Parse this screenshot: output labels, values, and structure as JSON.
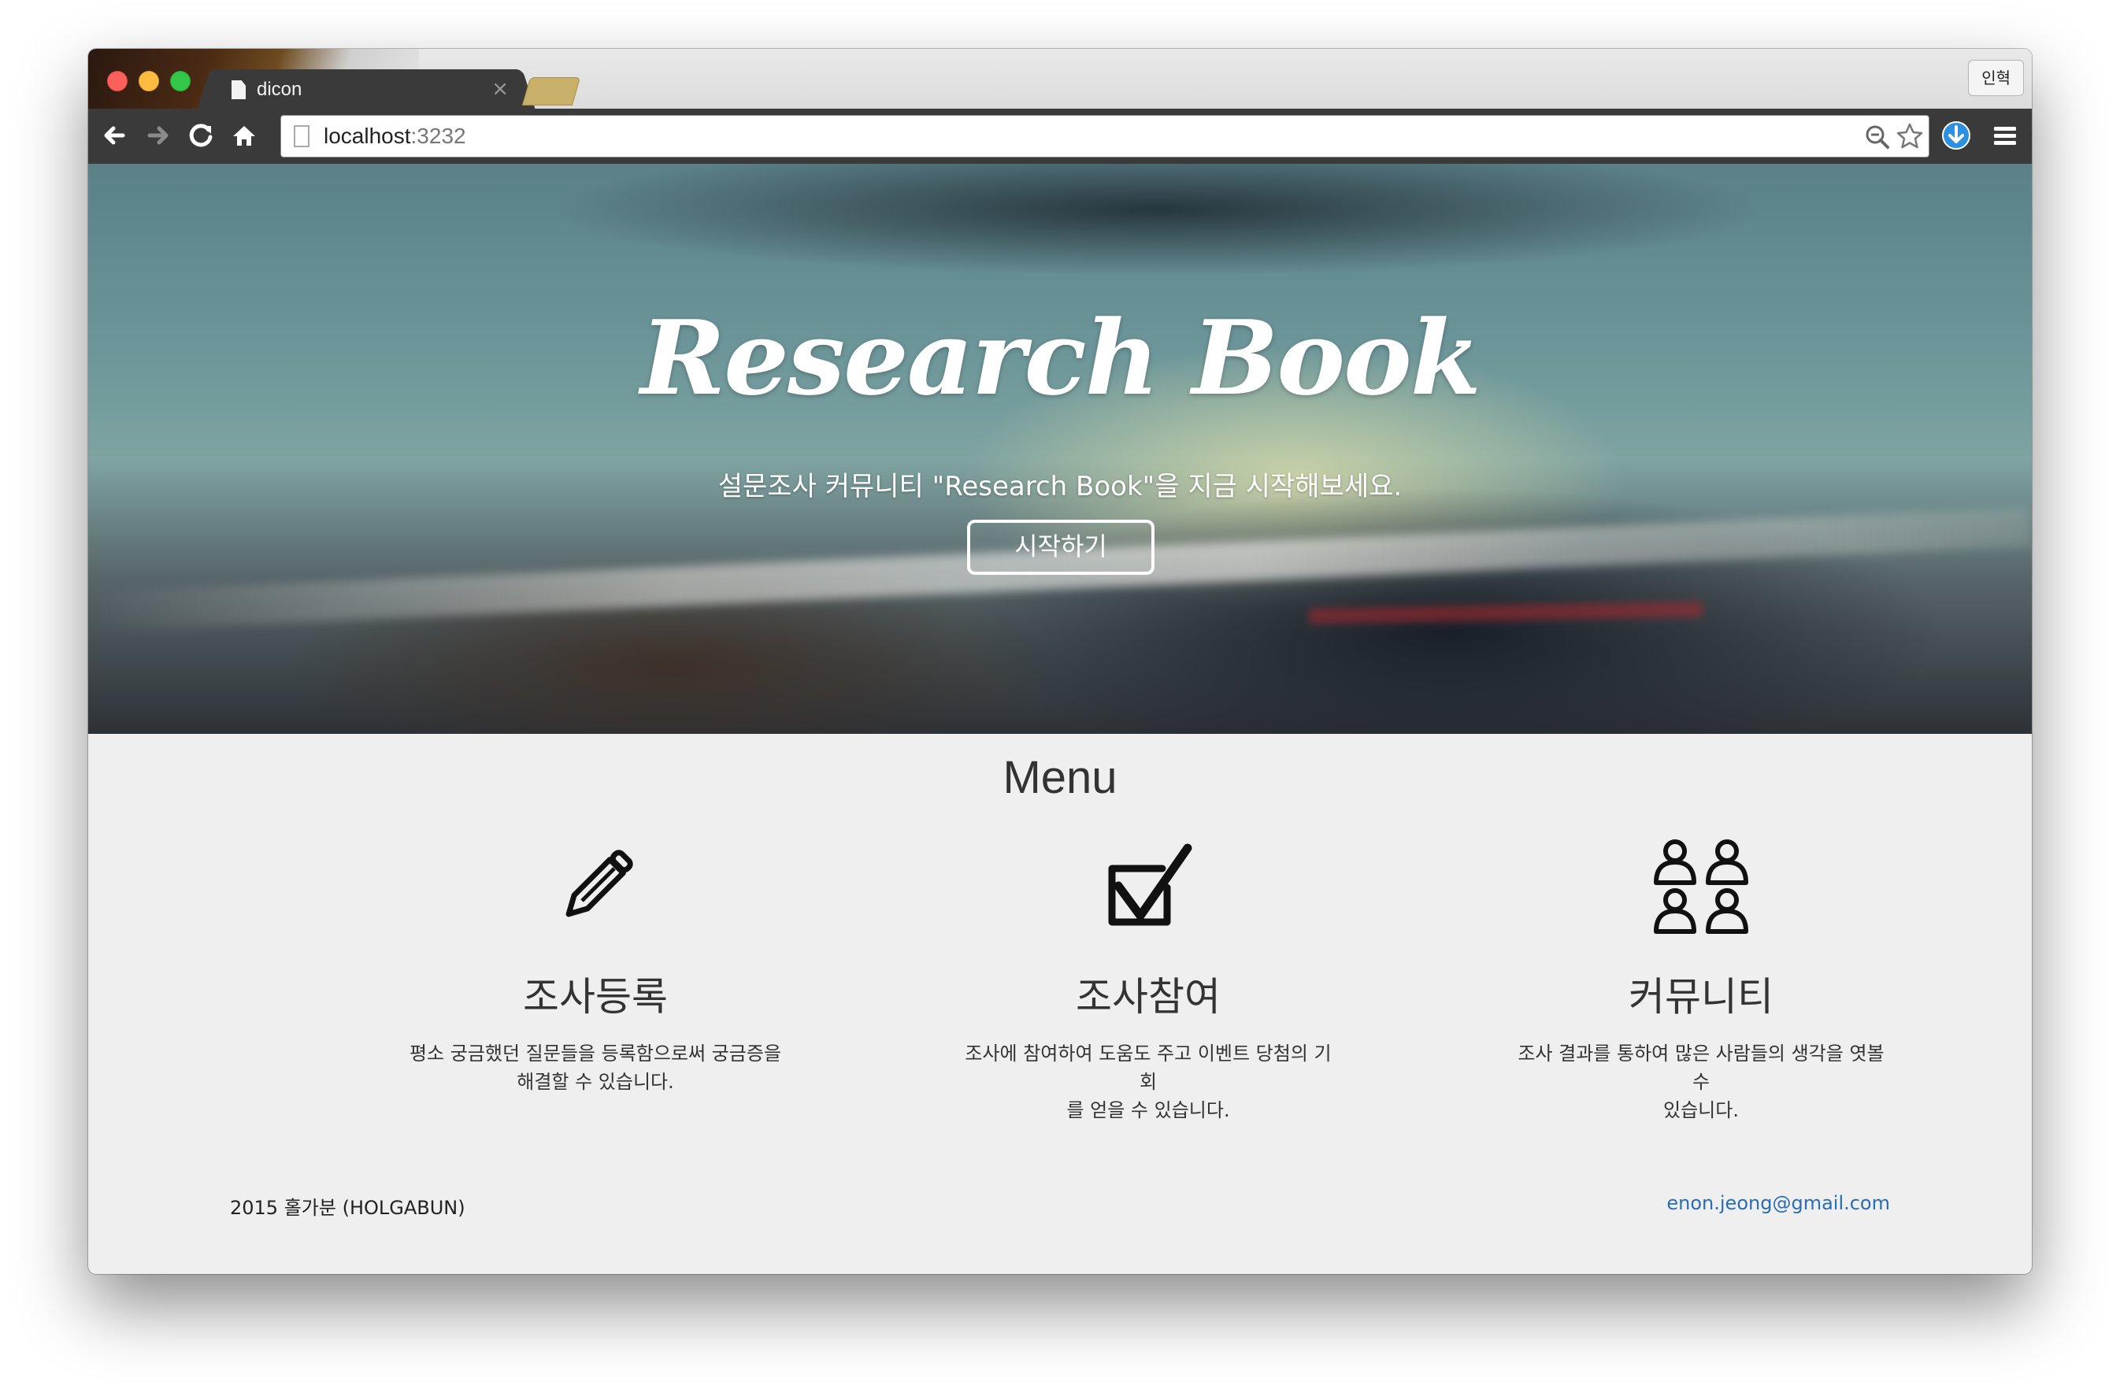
{
  "browser": {
    "tab_title": "dicon",
    "tab_close": "×",
    "profile_button": "인혁",
    "url_host": "localhost",
    "url_port": ":3232"
  },
  "hero": {
    "title": "Research Book",
    "subtitle": "설문조사 커뮤니티 \"Research Book\"을 지금 시작해보세요.",
    "cta_label": "시작하기"
  },
  "menu": {
    "title": "Menu",
    "items": [
      {
        "icon": "pencil-icon",
        "title": "조사등록",
        "desc_line1": "평소 궁금했던 질문들을 등록함으로써 궁금증을",
        "desc_line2": "해결할 수 있습니다."
      },
      {
        "icon": "checkbox-icon",
        "title": "조사참여",
        "desc_line1": "조사에 참여하여 도움도 주고 이벤트 당첨의 기회",
        "desc_line2": "를 얻을 수 있습니다."
      },
      {
        "icon": "people-icon",
        "title": "커뮤니티",
        "desc_line1": "조사 결과를 통하여 많은 사람들의 생각을 엿볼 수",
        "desc_line2": "있습니다."
      }
    ]
  },
  "footer": {
    "copyright": "2015 홀가분 (HOLGABUN)",
    "email": "enon.jeong@gmail.com"
  },
  "colors": {
    "toolbar": "#3a3a3a",
    "page_bg": "#efefef",
    "link": "#2a6db5",
    "traffic_red": "#fc605c",
    "traffic_yellow": "#fdbc40",
    "traffic_green": "#34c84a"
  }
}
